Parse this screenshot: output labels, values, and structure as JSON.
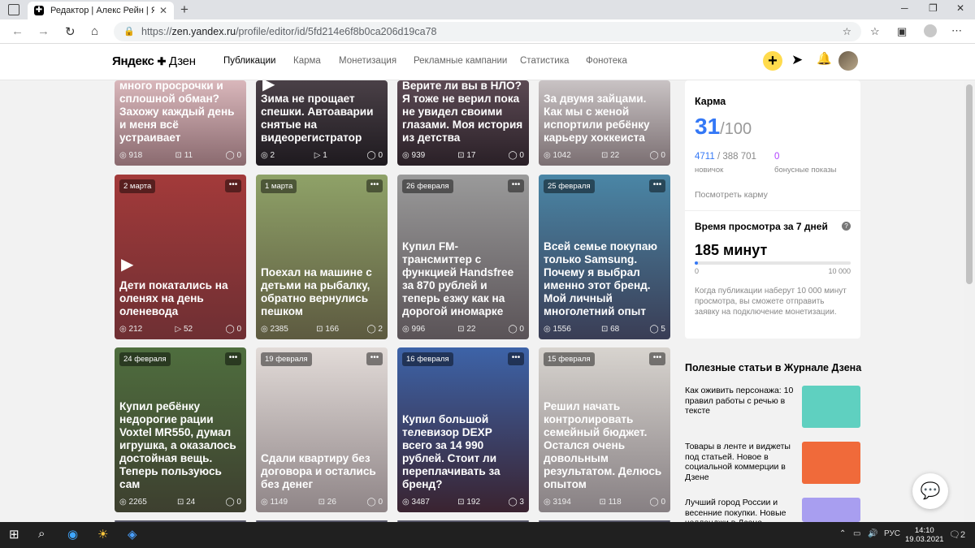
{
  "browser": {
    "tab_title": "Редактор | Алекс Рейн | Яндекс",
    "url_prefix": "https://",
    "url_domain": "zen.yandex.ru",
    "url_path": "/profile/editor/id/5fd214e6f8b0ca206d19ca78"
  },
  "header": {
    "logo_yandex": "Яндекс",
    "logo_zen": "Дзен",
    "nav": [
      "Публикации",
      "Карма",
      "Монетизация",
      "Рекламные кампании",
      "Статистика",
      "Фонотека"
    ]
  },
  "cards": [
    {
      "title": "сетевых магазинах много просрочки и сплошной обман? Захожу каждый день и меня всё устраивает",
      "date": "",
      "views": "918",
      "reads": "11",
      "comments": "0",
      "video": false,
      "colors": [
        "#d9b7bb",
        "#8a6a6f"
      ]
    },
    {
      "title": "Зима не прощает спешки. Автоаварии снятые на видеорегистратор",
      "date": "",
      "views": "2",
      "reads": "1",
      "comments": "0",
      "video": true,
      "colors": [
        "#4a4047",
        "#1e1a1f"
      ]
    },
    {
      "title": "Верите ли вы в НЛО? Я тоже не верил пока не увидел своими глазами. Моя история из детства",
      "date": "",
      "views": "939",
      "reads": "17",
      "comments": "0",
      "video": false,
      "colors": [
        "#5c4a54",
        "#2a2027"
      ]
    },
    {
      "title": "За двумя зайцами. Как мы с женой испортили ребёнку карьеру хоккеиста",
      "date": "",
      "views": "1042",
      "reads": "22",
      "comments": "0",
      "video": false,
      "colors": [
        "#c9c3c4",
        "#7b6f72"
      ]
    },
    {
      "title": "Дети покатались на оленях на день оленевода",
      "date": "2 марта",
      "views": "212",
      "reads": "52",
      "comments": "0",
      "video": true,
      "colors": [
        "#a33a3a",
        "#6e2f33"
      ]
    },
    {
      "title": "Поехал на машине с детьми на рыбалку, обратно вернулись пешком",
      "date": "1 марта",
      "views": "2385",
      "reads": "166",
      "comments": "2",
      "video": false,
      "colors": [
        "#8fa268",
        "#5d5a40"
      ]
    },
    {
      "title": "Купил FM-трансмиттер с функцией Handsfree за 870 рублей и теперь езжу как на дорогой иномарке",
      "date": "26 февраля",
      "views": "996",
      "reads": "22",
      "comments": "0",
      "video": false,
      "colors": [
        "#9a9a9a",
        "#5a5357"
      ]
    },
    {
      "title": "Всей семье покупаю только Samsung. Почему я выбрал именно этот бренд. Мой личный многолетний опыт",
      "date": "25 февраля",
      "views": "1556",
      "reads": "68",
      "comments": "5",
      "video": false,
      "colors": [
        "#4a86a6",
        "#3a3d55"
      ]
    },
    {
      "title": "Купил ребёнку недорогие рации Voxtel MR550, думал игрушка, а оказалось достойная вещь. Теперь пользуюсь сам",
      "date": "24 февраля",
      "views": "2265",
      "reads": "24",
      "comments": "0",
      "video": false,
      "colors": [
        "#4f6e3e",
        "#3d3f2f"
      ]
    },
    {
      "title": "Сдали квартиру без договора и остались без денег",
      "date": "19 февраля",
      "views": "1149",
      "reads": "26",
      "comments": "0",
      "video": false,
      "colors": [
        "#e2dbd8",
        "#8f8587"
      ]
    },
    {
      "title": "Купил большой телевизор DEXP всего за 14 990 рублей. Стоит ли переплачивать за бренд?",
      "date": "16 февраля",
      "views": "3487",
      "reads": "192",
      "comments": "3",
      "video": false,
      "colors": [
        "#3d63a8",
        "#3a2330"
      ]
    },
    {
      "title": "Решил начать контролировать семейный бюджет. Остался очень довольным результатом. Делюсь опытом",
      "date": "15 февраля",
      "views": "3194",
      "reads": "118",
      "comments": "0",
      "video": false,
      "colors": [
        "#d8d4cf",
        "#878083"
      ]
    }
  ],
  "karma": {
    "title": "Карма",
    "value": "31",
    "max": "/100",
    "points": "4711",
    "points_total": "/ 388 701",
    "points_label": "новичок",
    "bonus": "0",
    "bonus_label": "бонусные показы",
    "link": "Посмотреть карму"
  },
  "viewtime": {
    "title": "Время просмотра за 7 дней",
    "value": "185 минут",
    "progress": 0.0185,
    "min_label": "0",
    "max_label": "10 000",
    "note": "Когда публикации наберут 10 000 минут просмотра, вы сможете отправить заявку на подключение монетизации."
  },
  "useful": {
    "title": "Полезные статьи в Журнале Дзена",
    "articles": [
      {
        "text": "Как оживить персонажа: 10 правил работы с речью в тексте",
        "color": "#5fd0c0"
      },
      {
        "text": "Товары в ленте и виджеты под статьей. Новое в социальной коммерции в Дзене",
        "color": "#f06a3a"
      },
      {
        "text": "Лучший город России и весенние покупки. Новые челленджи в Дзене",
        "color": "#a89ef0"
      }
    ]
  },
  "taskbar": {
    "lang": "РУС",
    "time": "14:10",
    "date": "19.03.2021",
    "notifications": "2"
  }
}
